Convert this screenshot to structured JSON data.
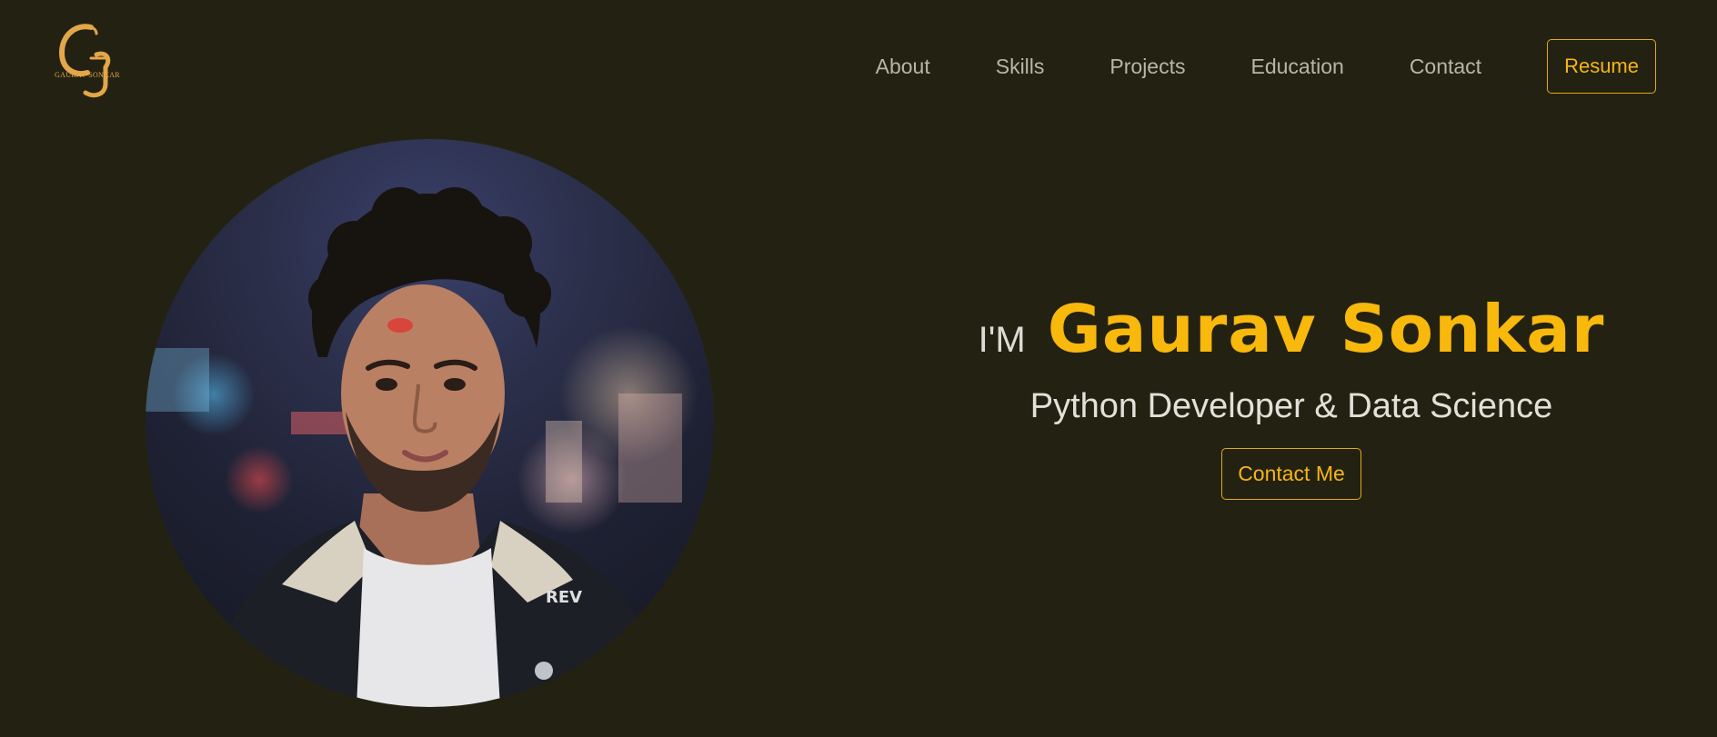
{
  "brand": {
    "logo_text": "GAURAV SONKAR",
    "accent_color": "#f5b517",
    "background_color": "#232212"
  },
  "nav": {
    "items": [
      {
        "label": "About"
      },
      {
        "label": "Skills"
      },
      {
        "label": "Projects"
      },
      {
        "label": "Education"
      },
      {
        "label": "Contact"
      }
    ],
    "resume_label": "Resume"
  },
  "hero": {
    "greeting": "I'M",
    "name": "Gaurav Sonkar",
    "role": "Python Developer & Data Science",
    "contact_label": "Contact Me",
    "portrait_icon": "profile-photo"
  }
}
